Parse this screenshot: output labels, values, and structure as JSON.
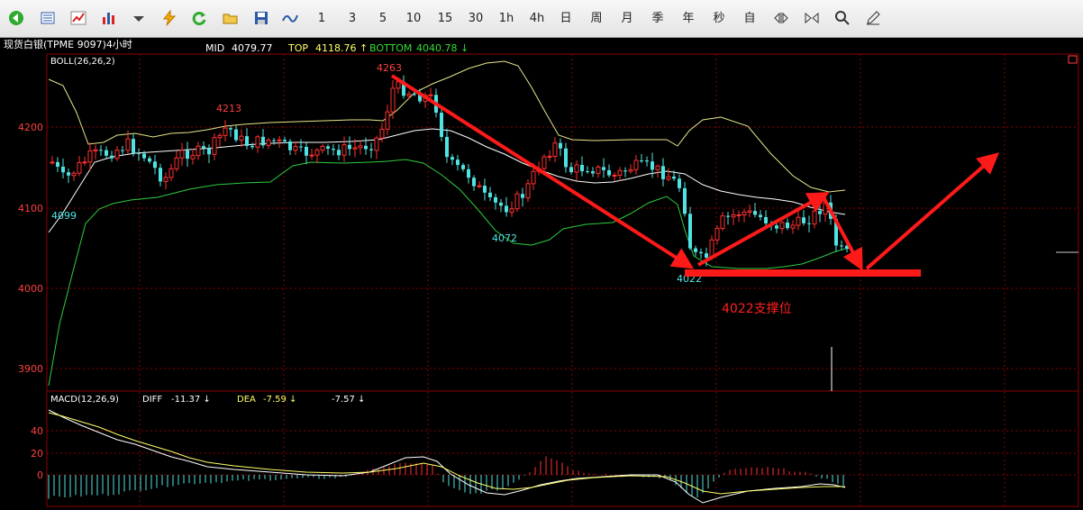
{
  "toolbar": {
    "icons": [
      "back-arrow-icon",
      "list-icon",
      "line-chart-icon",
      "bar-chart-icon",
      "dropdown-icon",
      "lightning-icon",
      "refresh-icon",
      "folder-open-icon",
      "save-icon",
      "wave-icon"
    ],
    "periods": [
      "1",
      "3",
      "5",
      "10",
      "15",
      "30",
      "1h",
      "4h",
      "日",
      "周",
      "月",
      "季",
      "年",
      "秒",
      "自"
    ],
    "tools": [
      "expand-icon",
      "shrink-icon",
      "search-icon",
      "pen-icon"
    ]
  },
  "header": {
    "symbol": "现货白银(TPME 9097)4小时",
    "mid_label": "MID",
    "mid_value": "4079.77",
    "top_label": "TOP",
    "top_value": "4118.76 ↑",
    "bottom_label": "BOTTOM",
    "bottom_value": "4040.78 ↓"
  },
  "main_panel": {
    "indicator": "BOLL(26,26,2)",
    "y_ticks": [
      "4200",
      "4100",
      "4000",
      "3900"
    ],
    "price_labels": {
      "high_left": "4213",
      "high_peak": "4263",
      "low_left": "4099",
      "low_mid": "4072",
      "low_right": "4022"
    },
    "annotation": "4022支撑位"
  },
  "macd_panel": {
    "indicator": "MACD(12,26,9)",
    "diff_label": "DIFF",
    "diff_value": "-11.37 ↓",
    "dea_label": "DEA",
    "dea_value": "-7.59 ↓",
    "macd_value": "-7.57 ↓",
    "y_ticks": [
      "40",
      "20",
      "0"
    ]
  },
  "colors": {
    "grid": "#8b0000",
    "up": "#ff3030",
    "down": "#4fe3e3",
    "mid_band": "#ffffff",
    "upper_band": "#e6e68a",
    "lower_band": "#2ecc40",
    "arrow": "#ff1a1a",
    "axis_text": "#ff4040"
  }
}
